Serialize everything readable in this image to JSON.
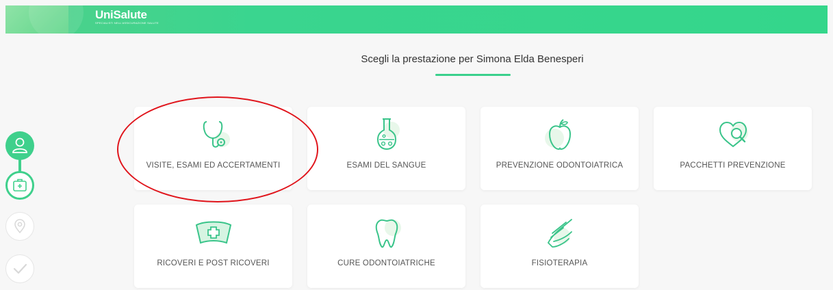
{
  "header": {
    "brand_name": "UniSalute",
    "brand_tagline": "SPECIALISTI NELL'ASSICURAZIONE SALUTE",
    "accent_color": "#34d68b"
  },
  "page": {
    "title": "Scegli la prestazione per Simona Elda Benesperi"
  },
  "services": [
    {
      "label": "VISITE, ESAMI ED ACCERTAMENTI",
      "icon": "stethoscope-icon"
    },
    {
      "label": "ESAMI DEL SANGUE",
      "icon": "flask-icon"
    },
    {
      "label": "PREVENZIONE ODONTOIATRICA",
      "icon": "apple-icon"
    },
    {
      "label": "PACCHETTI PREVENZIONE",
      "icon": "heart-search-icon"
    },
    {
      "label": "RICOVERI E POST RICOVERI",
      "icon": "nurse-cap-icon"
    },
    {
      "label": "CURE ODONTOIATRICHE",
      "icon": "tooth-icon"
    },
    {
      "label": "FISIOTERAPIA",
      "icon": "hand-icon"
    }
  ],
  "stepper": {
    "steps": [
      {
        "icon": "user-icon",
        "state": "completed"
      },
      {
        "icon": "medical-kit-icon",
        "state": "current"
      },
      {
        "icon": "location-pin-icon",
        "state": "pending"
      },
      {
        "icon": "checkmark-icon",
        "state": "pending"
      }
    ]
  },
  "annotation": {
    "highlight_color": "#e0141b"
  }
}
